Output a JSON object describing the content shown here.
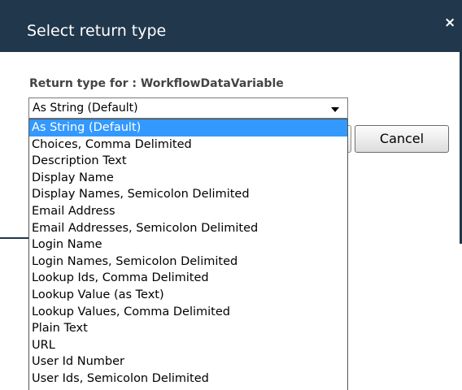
{
  "dialog": {
    "title": "Select return type",
    "close_label": "×",
    "field_label": "Return type for : WorkflowDataVariable",
    "select": {
      "value": "As String (Default)",
      "options": [
        "As String (Default)",
        "Choices, Comma Delimited",
        "Description Text",
        "Display Name",
        "Display Names, Semicolon Delimited",
        "Email Address",
        "Email Addresses, Semicolon Delimited",
        "Login Name",
        "Login Names, Semicolon Delimited",
        "Lookup Ids, Comma Delimited",
        "Lookup Value (as Text)",
        "Lookup Values, Comma Delimited",
        "Plain Text",
        "URL",
        "User Id Number",
        "User Ids, Semicolon Delimited"
      ],
      "selected_index": 0
    },
    "cancel_label": "Cancel"
  },
  "colors": {
    "titlebar": "#21374c",
    "selection": "#3399ff",
    "label_text": "#444444"
  },
  "icons": {
    "close": "close-icon",
    "dropdown": "chevron-down-icon"
  }
}
